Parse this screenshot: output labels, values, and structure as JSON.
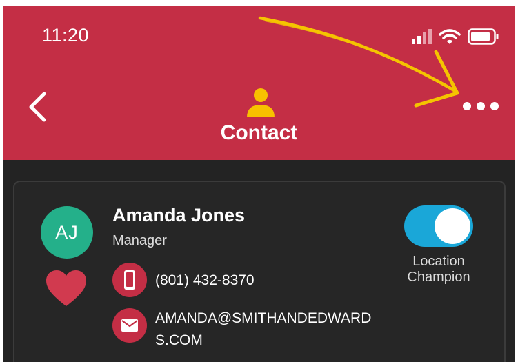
{
  "status_bar": {
    "time": "11:20",
    "icons": [
      "cellular-signal-icon",
      "wifi-icon",
      "battery-icon"
    ]
  },
  "header": {
    "title": "Contact",
    "icon": "person-icon",
    "back_icon": "chevron-left-icon",
    "more_icon": "more-horizontal-icon"
  },
  "contact": {
    "initials": "AJ",
    "name": "Amanda Jones",
    "role": "Manager",
    "phone": "(801) 432-8370",
    "email": "AMANDA@SMITHANDEDWARDS.COM",
    "favorite_icon": "heart-icon",
    "location_champion_label": "Location Champion",
    "location_champion_on": true
  },
  "colors": {
    "header_bg": "#c42e45",
    "background": "#232323",
    "accent_icon": "#f8c100",
    "avatar_bg": "#24b08a",
    "toggle_on": "#1aa7d8",
    "annotation_arrow": "#f5c400"
  }
}
